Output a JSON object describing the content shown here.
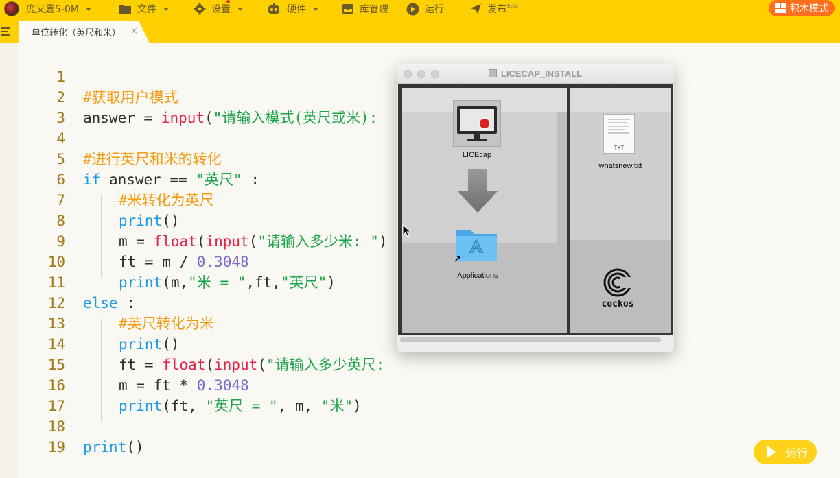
{
  "topbar": {
    "user": "庞又嘉5-0M",
    "menu": {
      "file": "文件",
      "settings": "设置",
      "hardware": "硬件",
      "library": "库管理",
      "run": "运行",
      "publish": "发布",
      "publish_badge": "Beta"
    },
    "block_mode": "积木模式"
  },
  "tabs": [
    {
      "label": "单位转化（英尺和米）",
      "close": "×"
    }
  ],
  "editor": {
    "line_numbers": [
      "1",
      "2",
      "3",
      "4",
      "5",
      "6",
      "7",
      "8",
      "9",
      "10",
      "11",
      "12",
      "13",
      "14",
      "15",
      "16",
      "17",
      "18",
      "19"
    ],
    "code": {
      "l1": "#获取用户模式",
      "l2_var": "answer = ",
      "l2_fn": "input",
      "l2_paren": "(",
      "l2_str": "\"请输入模式(英尺或米):",
      "l4": "#进行英尺和米的转化",
      "l5_kw": "if",
      "l5_mid": " answer == ",
      "l5_str": "\"英尺\"",
      "l5_end": " :",
      "l6": "#米转化为英尺",
      "l7_fn": "print",
      "l7_end": "()",
      "l8_var": "m = ",
      "l8_fn1": "float",
      "l8_p1": "(",
      "l8_fn2": "input",
      "l8_p2": "(",
      "l8_str": "\"请输入多少米: \"",
      "l8_end": ")",
      "l9_var": "ft = m / ",
      "l9_num": "0.3048",
      "l10_fn": "print",
      "l10_a": "(m,",
      "l10_s1": "\"米 = \"",
      "l10_b": ",ft,",
      "l10_s2": "\"英尺\"",
      "l10_c": ")",
      "l11_kw": "else",
      "l11_end": " :",
      "l12": "#英尺转化为米",
      "l13_fn": "print",
      "l13_end": "()",
      "l14_var": "ft = ",
      "l14_fn1": "float",
      "l14_p1": "(",
      "l14_fn2": "input",
      "l14_p2": "(",
      "l14_str": "\"请输入多少英尺:",
      "l15_var": "m = ft * ",
      "l15_num": "0.3048",
      "l16_fn": "print",
      "l16_a": "(ft, ",
      "l16_s1": "\"英尺 = \"",
      "l16_b": ", m, ",
      "l16_s2": "\"米\"",
      "l16_c": ")",
      "l18_fn": "print",
      "l18_end": "()"
    }
  },
  "finder": {
    "title": "LICECAP_INSTALL",
    "items": {
      "app": "LICEcap",
      "folder": "Applications",
      "file": "whatsnew.txt",
      "file_ext": "TXT",
      "brand": "cockos"
    }
  },
  "run_button": {
    "label": "运行"
  },
  "colors": {
    "topbar": "#ffd000",
    "comment": "#f39c12",
    "keyword": "#1a9be6",
    "function": "#e6224a",
    "string": "#1aa34a",
    "number": "#7a6ad0"
  }
}
